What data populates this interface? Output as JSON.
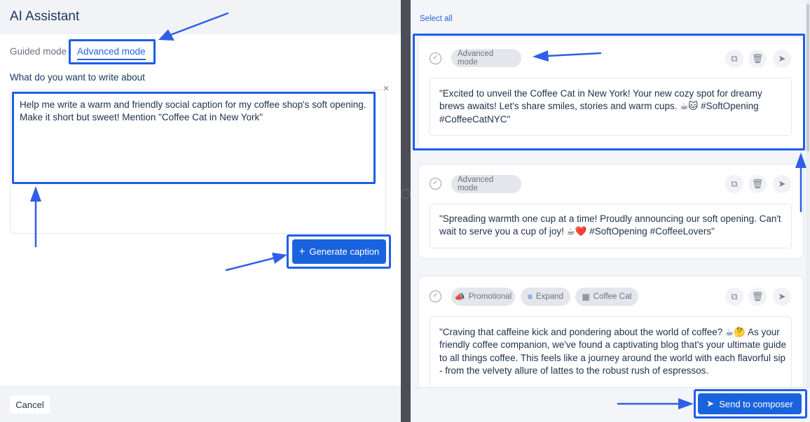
{
  "left": {
    "title": "AI Assistant",
    "tabs": {
      "guided": "Guided mode",
      "advanced": "Advanced mode"
    },
    "prompt_label": "What do you want to write about",
    "prompt_value": "Help me write a warm and friendly social caption for my coffee shop's soft opening. Make it short but sweet! Mention \"Coffee Cat in New York\"",
    "close_glyph": "×",
    "generate_label": "Generate caption",
    "generate_glyph": "+",
    "cancel_label": "Cancel"
  },
  "right": {
    "select_all": "Select all",
    "cards": [
      {
        "chips": [
          {
            "label": "Advanced mode"
          }
        ],
        "caption": "\"Excited to unveil the Coffee Cat in New York! Your new cozy spot for dreamy brews awaits! Let's share smiles, stories and warm cups. ☕🐱 #SoftOpening #CoffeeCatNYC\""
      },
      {
        "chips": [
          {
            "label": "Advanced mode"
          }
        ],
        "caption": "\"Spreading warmth one cup at a time! Proudly announcing our soft opening. Can't wait to serve you a cup of joy! ☕❤️ #SoftOpening #CoffeeLovers\""
      },
      {
        "chips": [
          {
            "label": "Promotional",
            "icon": "megaphone-icon",
            "glyph": "📣"
          },
          {
            "label": "Expand",
            "icon": "lines-icon",
            "glyph": "≡"
          },
          {
            "label": "Coffee Cat",
            "icon": "building-icon",
            "glyph": "▦"
          }
        ],
        "caption": "\"Craving that caffeine kick and pondering about the world of coffee? ☕🤔 As your friendly coffee companion, we've found a captivating blog that's your ultimate guide to all things coffee. This feels like a journey around the world with each flavorful sip - from the velvety allure of lattes to the robust rush of espressos."
      }
    ],
    "action_glyphs": {
      "copy": "⧉",
      "delete": "🗑",
      "send": "➤"
    },
    "check_glyph": "✓",
    "send_label": "Send to composer",
    "send_glyph": "➤"
  },
  "colors": {
    "accent": "#1a63de",
    "highlight": "#1e5ee8"
  }
}
